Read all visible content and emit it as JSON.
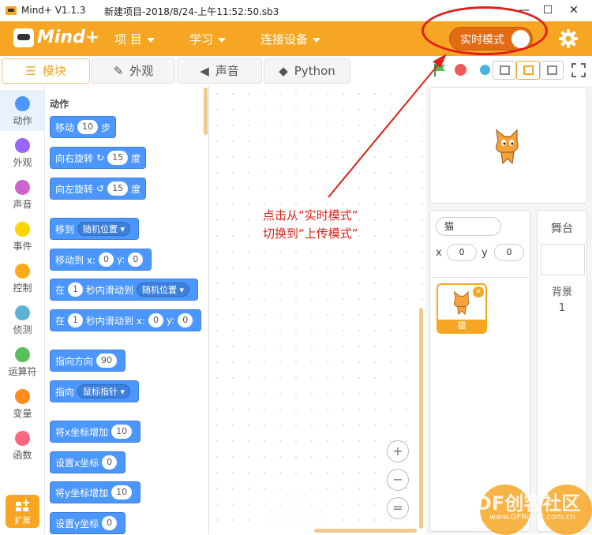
{
  "window": {
    "app_title": "Mind+ V1.1.3",
    "doc_title": "新建项目-2018/8/24-上午11:52:50.sb3",
    "minimize": "—",
    "maximize": "☐",
    "close": "✕"
  },
  "menu": {
    "logo": "Mind+",
    "items": [
      "项 目",
      "学习",
      "连接设备"
    ],
    "mode_toggle": "实时模式"
  },
  "tabs": [
    {
      "label": "模块",
      "icon": "blocks-icon",
      "active": true
    },
    {
      "label": "外观",
      "icon": "brush-icon",
      "active": false
    },
    {
      "label": "声音",
      "icon": "speaker-icon",
      "active": false
    },
    {
      "label": "Python",
      "icon": "python-icon",
      "active": false
    }
  ],
  "categories": [
    {
      "name": "动作",
      "color": "#4c97ff"
    },
    {
      "name": "外观",
      "color": "#9966ff"
    },
    {
      "name": "声音",
      "color": "#cf63cf"
    },
    {
      "name": "事件",
      "color": "#ffd500"
    },
    {
      "name": "控制",
      "color": "#ffab19"
    },
    {
      "name": "侦测",
      "color": "#5cb1d6"
    },
    {
      "name": "运算符",
      "color": "#59c059"
    },
    {
      "name": "变量",
      "color": "#ff8c1a"
    },
    {
      "name": "函数",
      "color": "#ff6680"
    }
  ],
  "extension_label": "扩展",
  "palette": {
    "section_title": "动作",
    "blocks": {
      "move": {
        "a": "移动",
        "v": "10",
        "b": "步"
      },
      "turn_right": {
        "a": "向右旋转",
        "icon": "↻",
        "v": "15",
        "b": "度"
      },
      "turn_left": {
        "a": "向左旋转",
        "icon": "↺",
        "v": "15",
        "b": "度"
      },
      "goto": {
        "a": "移到",
        "dd": "随机位置"
      },
      "goto_xy": {
        "a": "移动到 x:",
        "x": "0",
        "m": "y:",
        "y": "0"
      },
      "glide": {
        "a": "在",
        "v": "1",
        "m": "秒内滑动到",
        "dd": "随机位置"
      },
      "glide_xy": {
        "a": "在",
        "v": "1",
        "m": "秒内滑动到 x:",
        "x": "0",
        "n": "y:",
        "y": "0"
      },
      "point_dir": {
        "a": "指向方向",
        "v": "90"
      },
      "point_to": {
        "a": "指向",
        "dd": "鼠标指针"
      },
      "change_x": {
        "a": "将x坐标增加",
        "v": "10"
      },
      "set_x": {
        "a": "设置x坐标",
        "v": "0"
      },
      "change_y": {
        "a": "将y坐标增加",
        "v": "10"
      },
      "set_y": {
        "a": "设置y坐标",
        "v": "0"
      }
    }
  },
  "annotation": {
    "line1": "点击从“实时模式”",
    "line2": "切换到“上传模式”"
  },
  "zoom": {
    "in": "+",
    "out": "−",
    "reset": "="
  },
  "sprite": {
    "name": "猫",
    "x_label": "x",
    "x": "0",
    "y_label": "y",
    "y": "0",
    "card_label": "猫"
  },
  "stage": {
    "title": "舞台",
    "backdrop_label": "背景",
    "backdrop_count": "1"
  },
  "watermark": {
    "text": "DF创客社区",
    "url": "www.DFRobot.com.cn"
  },
  "colors": {
    "accent": "#f6a623",
    "motion_block": "#4c97ff",
    "annotation_red": "#e0201b"
  }
}
